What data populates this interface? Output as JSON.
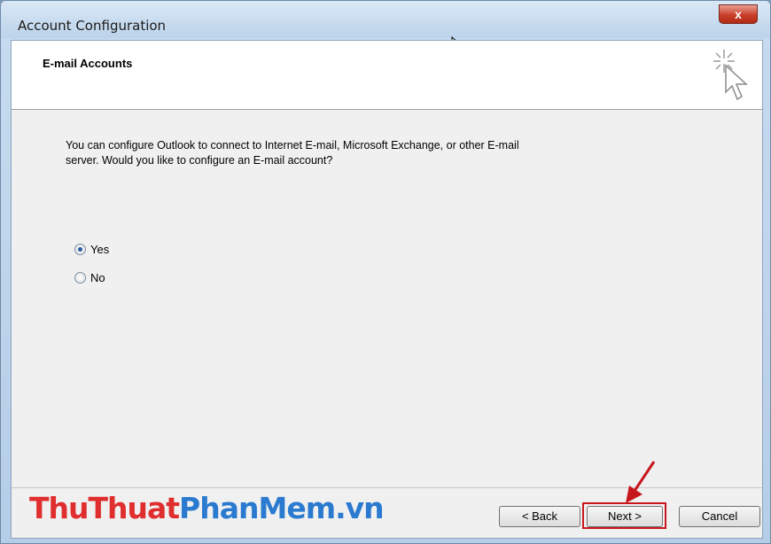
{
  "window": {
    "title": "Account Configuration",
    "close_label": "x"
  },
  "header": {
    "title": "E-mail Accounts",
    "icon": "wizard-cursor-sparkle-icon"
  },
  "body": {
    "description": "You can configure Outlook to connect to Internet E-mail, Microsoft Exchange, or other E-mail server. Would you like to configure an E-mail account?",
    "options": [
      {
        "label": "Yes",
        "checked": true
      },
      {
        "label": "No",
        "checked": false
      }
    ]
  },
  "footer": {
    "back_label": "< Back",
    "next_label": "Next >",
    "cancel_label": "Cancel"
  },
  "watermark": {
    "part1": "ThuThuat",
    "part2": "PhanMem",
    "part3": ".vn"
  },
  "colors": {
    "highlight": "#c8161d",
    "watermark_red": "#e02d2d",
    "watermark_blue": "#2a7ad0"
  }
}
